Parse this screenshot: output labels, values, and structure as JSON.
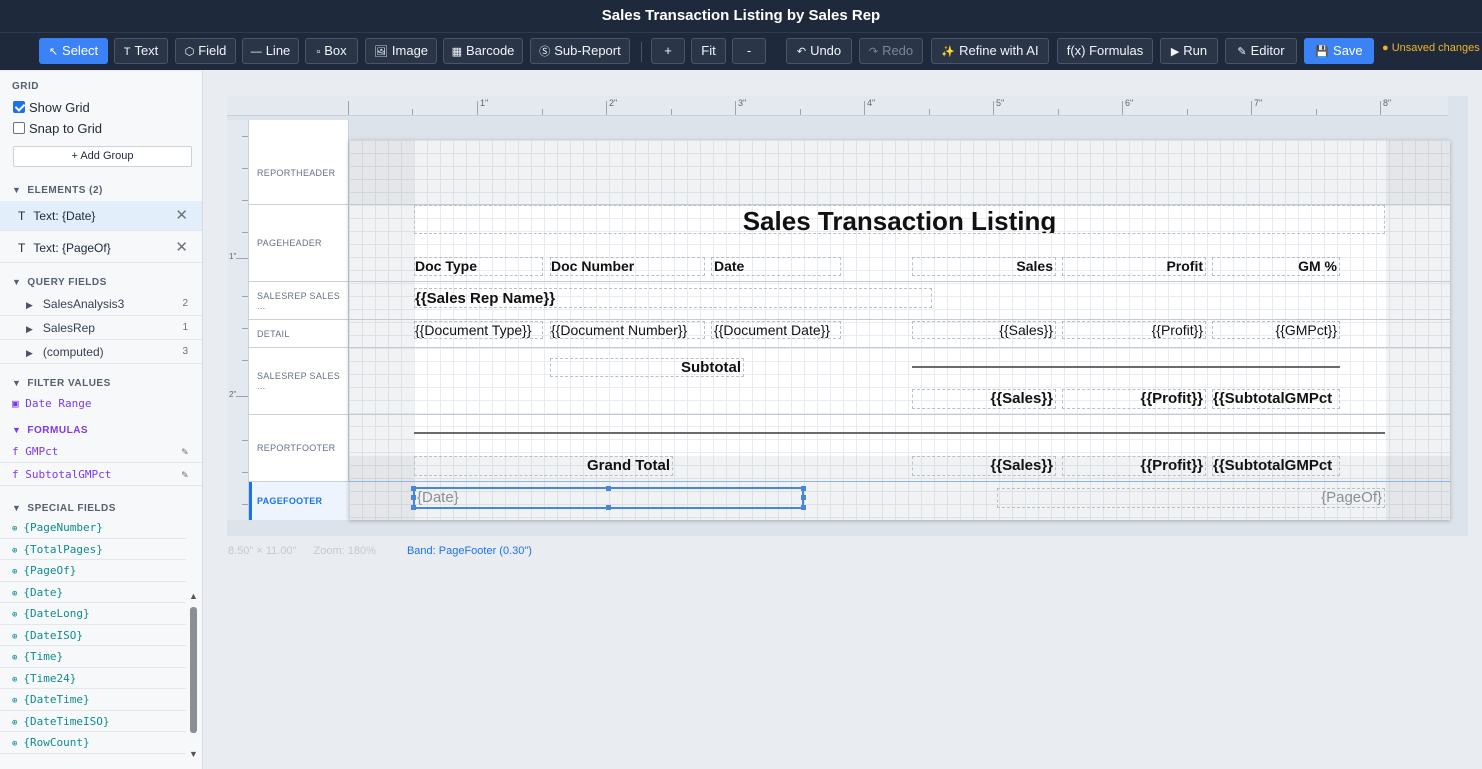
{
  "app": {
    "title": "Sales Transaction Listing by Sales Rep",
    "unsaved": "● Unsaved changes"
  },
  "toolbar": {
    "select": "Select",
    "text": "Text",
    "field": "Field",
    "line": "Line",
    "box": "Box",
    "image": "Image",
    "barcode": "Barcode",
    "subreport": "Sub-Report",
    "zoom_in": "+",
    "fit": "Fit",
    "zoom_out": "-",
    "undo": "Undo",
    "redo": "Redo",
    "refine": "Refine with AI",
    "formulas": "f(x) Formulas",
    "run": "Run",
    "editor": "Editor",
    "save": "Save",
    "icons": {
      "select": "↖",
      "text": "T",
      "field": "⬡",
      "line": "—",
      "box": "▫",
      "image": "🖼",
      "barcode": "▦",
      "subreport": "Ⓢ",
      "undo": "↶",
      "redo": "↷",
      "refine": "✨",
      "run": "▶",
      "editor": "✎",
      "save": "💾"
    }
  },
  "sidebar": {
    "grid_title": "GRID",
    "show_grid": "Show Grid",
    "snap_to_grid": "Snap to Grid",
    "add_group": "+ Add Group",
    "elements_title": "ELEMENTS (2)",
    "elements": [
      {
        "icon": "T",
        "label": "Text: {Date}"
      },
      {
        "icon": "T",
        "label": "Text: {PageOf}"
      }
    ],
    "query_fields_title": "QUERY FIELDS",
    "query_fields": [
      {
        "label": "SalesAnalysis3",
        "count": "2"
      },
      {
        "label": "SalesRep",
        "count": "1"
      },
      {
        "label": "(computed)",
        "count": "3"
      }
    ],
    "filter_title": "FILTER VALUES",
    "filter_item": "Date Range",
    "formulas_title": "FORMULAS",
    "formulas": [
      {
        "label": "f GMPct"
      },
      {
        "label": "f SubtotalGMPct"
      }
    ],
    "special_title": "SPECIAL FIELDS",
    "special_fields": [
      "{PageNumber}",
      "{TotalPages}",
      "{PageOf}",
      "{Date}",
      "{DateLong}",
      "{DateISO}",
      "{Time}",
      "{Time24}",
      "{DateTime}",
      "{DateTimeISO}",
      "{RowCount}"
    ]
  },
  "ruler": {
    "top_labels": [
      "1\"",
      "2\"",
      "3\"",
      "4\"",
      "5\"",
      "6\"",
      "7\"",
      "8\""
    ],
    "left_labels": [
      "1\"",
      "2\""
    ]
  },
  "bands": [
    {
      "label": "REPORTHEADER"
    },
    {
      "label": "PAGEHEADER"
    },
    {
      "label": "SALESREP SALES ..."
    },
    {
      "label": "DETAIL"
    },
    {
      "label": "SALESREP SALES ..."
    },
    {
      "label": "REPORTFOOTER"
    },
    {
      "label": "PAGEFOOTER"
    }
  ],
  "report": {
    "title": "Sales Transaction Listing",
    "headers": {
      "doc_type": "Doc Type",
      "doc_number": "Doc Number",
      "date": "Date",
      "sales": "Sales",
      "profit": "Profit",
      "gm": "GM %"
    },
    "group_header": "{{Sales Rep Name}}",
    "detail": {
      "doc_type": "{{Document Type}}",
      "doc_number": "{{Document Number}}",
      "date": "{{Document Date}}",
      "sales": "{{Sales}}",
      "profit": "{{Profit}}",
      "gm": "{{GMPct}}"
    },
    "subtotal": {
      "label": "Subtotal",
      "sales": "{{Sales}}",
      "profit": "{{Profit}}",
      "gm": "{{SubtotalGMPct"
    },
    "grand_total": {
      "label": "Grand Total",
      "sales": "{{Sales}}",
      "profit": "{{Profit}}",
      "gm": "{{SubtotalGMPct"
    },
    "page_footer": {
      "date": "{Date}",
      "pageof": "{PageOf}"
    }
  },
  "status": {
    "size": "8.50\" × 11.00\"",
    "zoom": "Zoom: 180%",
    "band": "Band: PageFooter (0.30\")"
  },
  "colors": {
    "accent": "#3b82f6",
    "titlebar": "#1e2a3b",
    "unsaved": "#f0b429",
    "formula": "#7c3aed",
    "special": "#0f8b8d"
  }
}
